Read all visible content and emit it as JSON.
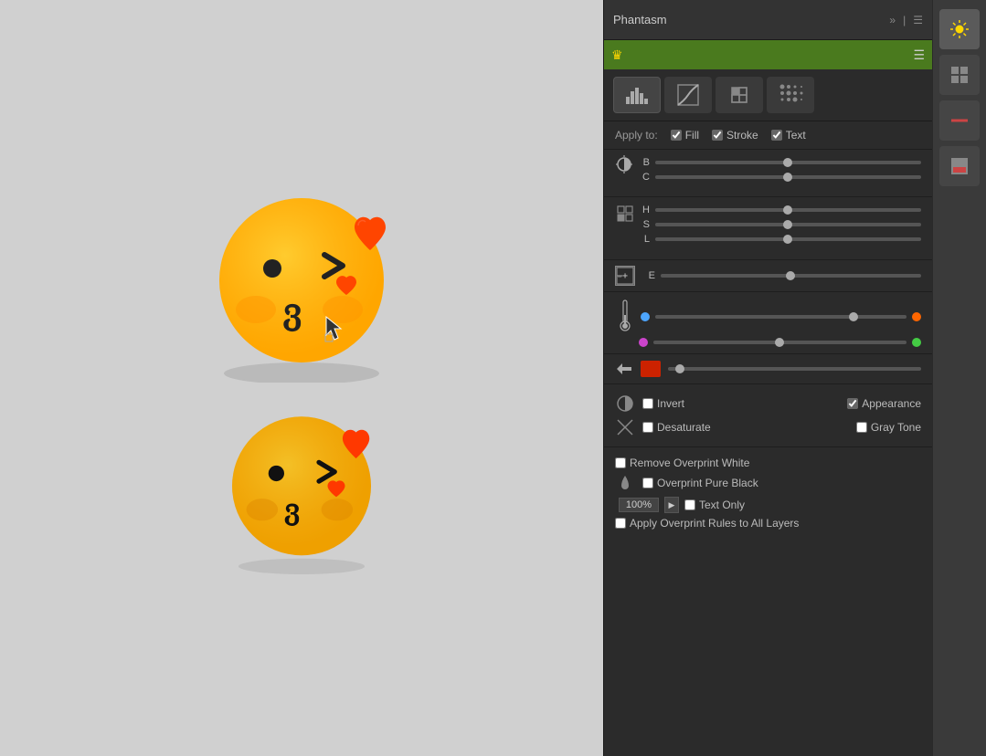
{
  "panel": {
    "title": "Phantasm",
    "tabs": [
      {
        "id": "histogram",
        "label": "Histogram"
      },
      {
        "id": "curves",
        "label": "Curves"
      },
      {
        "id": "layers",
        "label": "Layers"
      },
      {
        "id": "halftone",
        "label": "Halftone"
      }
    ],
    "apply_to": {
      "label": "Apply to:",
      "fill": {
        "label": "Fill",
        "checked": true
      },
      "stroke": {
        "label": "Stroke",
        "checked": true
      },
      "text": {
        "label": "Text",
        "checked": true
      }
    },
    "bc": {
      "b_label": "B",
      "c_label": "C",
      "b_value": 50,
      "c_value": 50
    },
    "hsl": {
      "h_label": "H",
      "s_label": "S",
      "l_label": "L",
      "h_value": 50,
      "s_value": 50,
      "l_value": 50
    },
    "e": {
      "label": "E",
      "value": 50
    },
    "color_balance": {
      "top_left_color": "#4da6ff",
      "top_right_color": "#ff6600",
      "bottom_left_color": "#cc44cc",
      "bottom_right_color": "#44cc44",
      "top_value": 80,
      "bottom_value": 50
    },
    "colorize": {
      "swatch_color": "#cc2200",
      "value": 5
    },
    "invert": {
      "label": "Invert",
      "checked": false,
      "appearance_label": "Appearance",
      "appearance_checked": true
    },
    "desaturate": {
      "label": "Desaturate",
      "checked": false,
      "gray_tone_label": "Gray Tone",
      "gray_tone_checked": false
    },
    "remove_overprint": {
      "label": "Remove Overprint White",
      "checked": false
    },
    "overprint_black": {
      "label": "Overprint Pure Black",
      "checked": false,
      "pct": "100%",
      "text_only_label": "Text Only",
      "text_only_checked": false
    },
    "apply_rules": {
      "label": "Apply Overprint Rules to All Layers",
      "checked": false
    }
  },
  "emojis": [
    {
      "id": "top",
      "label": "Kissing Face with Hearts"
    },
    {
      "id": "bottom",
      "label": "Kissing Face with Hearts 2"
    }
  ],
  "toolbar": {
    "items": [
      {
        "id": "sun",
        "symbol": "☀"
      },
      {
        "id": "grid",
        "symbol": "⊞"
      },
      {
        "id": "line",
        "symbol": "—"
      },
      {
        "id": "swatch",
        "symbol": "▣"
      }
    ]
  }
}
